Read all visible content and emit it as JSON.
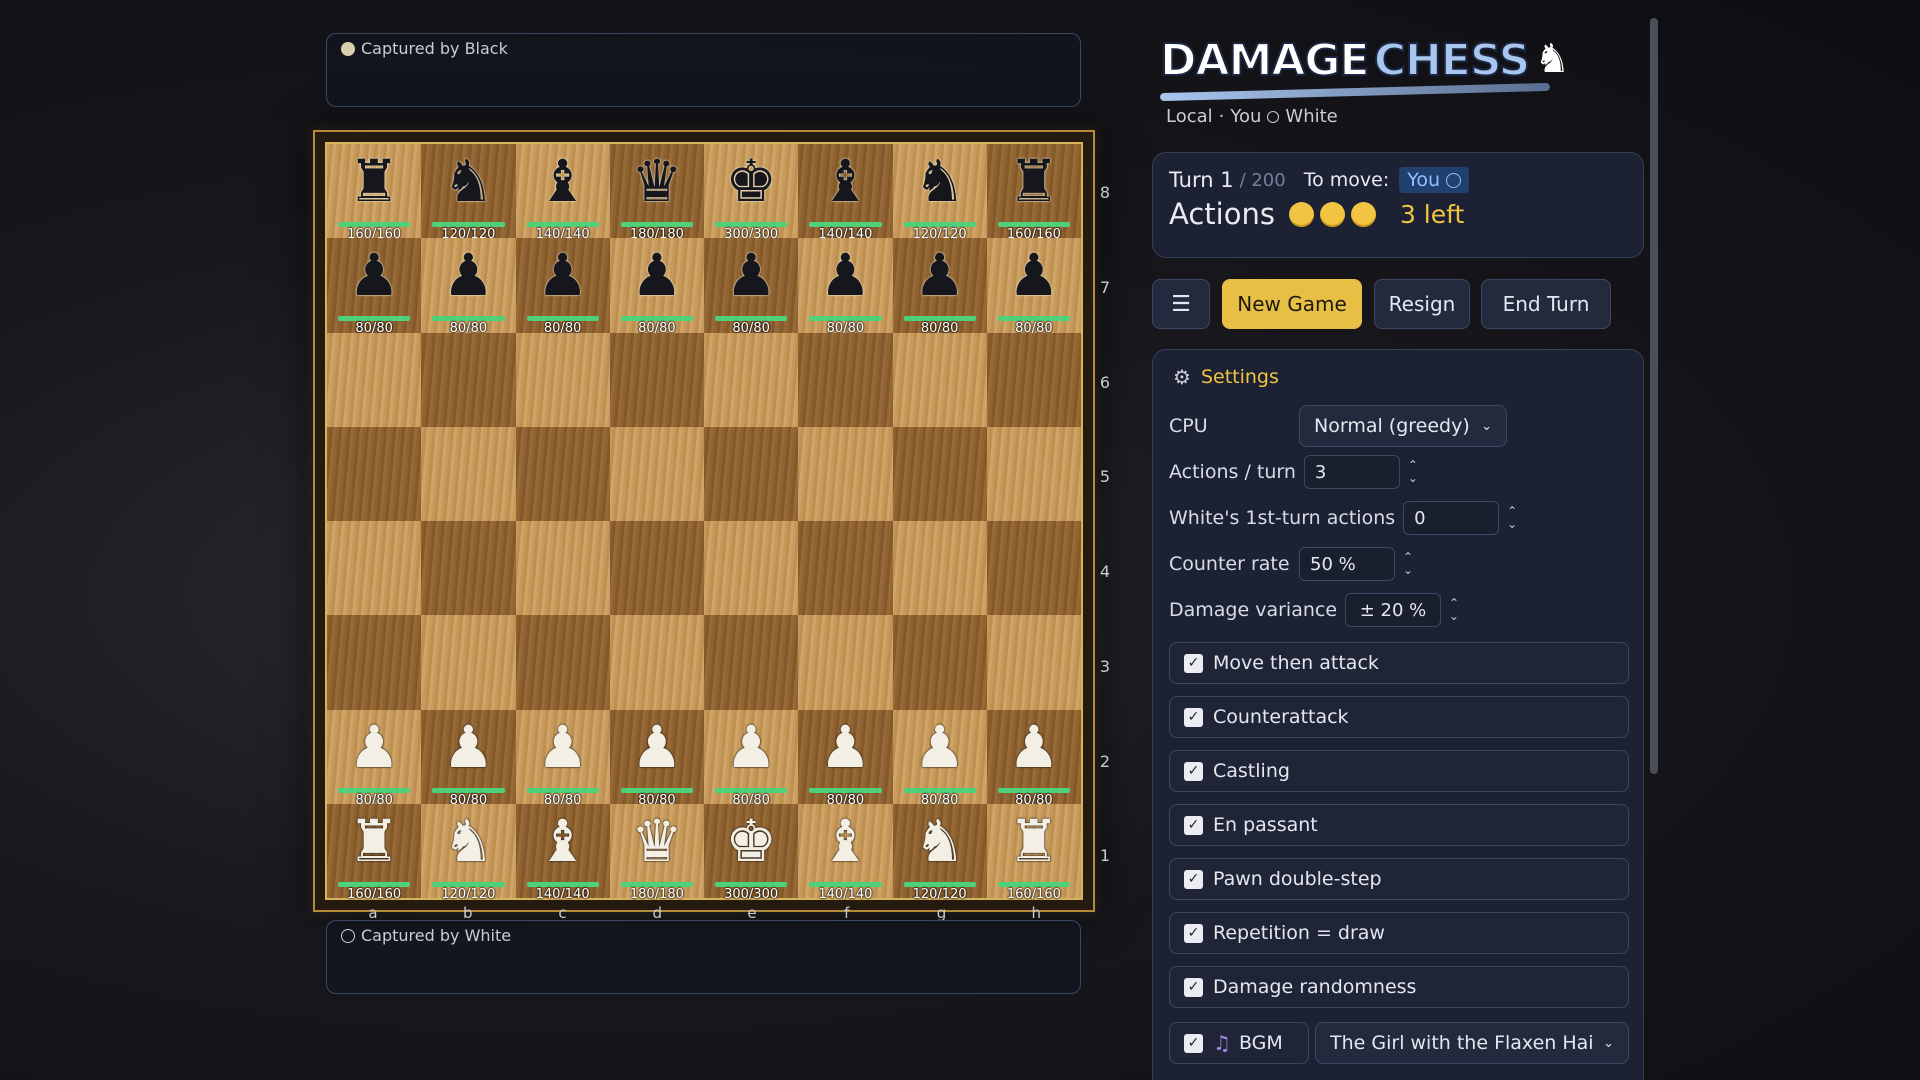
{
  "captured": {
    "top_label": "Captured by Black",
    "bottom_label": "Captured by White"
  },
  "board": {
    "files": [
      "a",
      "b",
      "c",
      "d",
      "e",
      "f",
      "g",
      "h"
    ],
    "ranks": [
      "8",
      "7",
      "6",
      "5",
      "4",
      "3",
      "2",
      "1"
    ],
    "pieces": [
      {
        "square": "a8",
        "color": "black",
        "type": "rook",
        "glyph": "♜",
        "hp": "160/160",
        "hp_fraction": 1.0
      },
      {
        "square": "b8",
        "color": "black",
        "type": "knight",
        "glyph": "♞",
        "hp": "120/120",
        "hp_fraction": 1.0
      },
      {
        "square": "c8",
        "color": "black",
        "type": "bishop",
        "glyph": "♝",
        "hp": "140/140",
        "hp_fraction": 1.0
      },
      {
        "square": "d8",
        "color": "black",
        "type": "queen",
        "glyph": "♛",
        "hp": "180/180",
        "hp_fraction": 1.0
      },
      {
        "square": "e8",
        "color": "black",
        "type": "king",
        "glyph": "♚",
        "hp": "300/300",
        "hp_fraction": 1.0
      },
      {
        "square": "f8",
        "color": "black",
        "type": "bishop",
        "glyph": "♝",
        "hp": "140/140",
        "hp_fraction": 1.0
      },
      {
        "square": "g8",
        "color": "black",
        "type": "knight",
        "glyph": "♞",
        "hp": "120/120",
        "hp_fraction": 1.0
      },
      {
        "square": "h8",
        "color": "black",
        "type": "rook",
        "glyph": "♜",
        "hp": "160/160",
        "hp_fraction": 1.0
      },
      {
        "square": "a7",
        "color": "black",
        "type": "pawn",
        "glyph": "♟",
        "hp": "80/80",
        "hp_fraction": 1.0
      },
      {
        "square": "b7",
        "color": "black",
        "type": "pawn",
        "glyph": "♟",
        "hp": "80/80",
        "hp_fraction": 1.0
      },
      {
        "square": "c7",
        "color": "black",
        "type": "pawn",
        "glyph": "♟",
        "hp": "80/80",
        "hp_fraction": 1.0
      },
      {
        "square": "d7",
        "color": "black",
        "type": "pawn",
        "glyph": "♟",
        "hp": "80/80",
        "hp_fraction": 1.0
      },
      {
        "square": "e7",
        "color": "black",
        "type": "pawn",
        "glyph": "♟",
        "hp": "80/80",
        "hp_fraction": 1.0
      },
      {
        "square": "f7",
        "color": "black",
        "type": "pawn",
        "glyph": "♟",
        "hp": "80/80",
        "hp_fraction": 1.0
      },
      {
        "square": "g7",
        "color": "black",
        "type": "pawn",
        "glyph": "♟",
        "hp": "80/80",
        "hp_fraction": 1.0
      },
      {
        "square": "h7",
        "color": "black",
        "type": "pawn",
        "glyph": "♟",
        "hp": "80/80",
        "hp_fraction": 1.0
      },
      {
        "square": "a2",
        "color": "white",
        "type": "pawn",
        "glyph": "♟",
        "hp": "80/80",
        "hp_fraction": 1.0
      },
      {
        "square": "b2",
        "color": "white",
        "type": "pawn",
        "glyph": "♟",
        "hp": "80/80",
        "hp_fraction": 1.0
      },
      {
        "square": "c2",
        "color": "white",
        "type": "pawn",
        "glyph": "♟",
        "hp": "80/80",
        "hp_fraction": 1.0
      },
      {
        "square": "d2",
        "color": "white",
        "type": "pawn",
        "glyph": "♟",
        "hp": "80/80",
        "hp_fraction": 1.0
      },
      {
        "square": "e2",
        "color": "white",
        "type": "pawn",
        "glyph": "♟",
        "hp": "80/80",
        "hp_fraction": 1.0
      },
      {
        "square": "f2",
        "color": "white",
        "type": "pawn",
        "glyph": "♟",
        "hp": "80/80",
        "hp_fraction": 1.0
      },
      {
        "square": "g2",
        "color": "white",
        "type": "pawn",
        "glyph": "♟",
        "hp": "80/80",
        "hp_fraction": 1.0
      },
      {
        "square": "h2",
        "color": "white",
        "type": "pawn",
        "glyph": "♟",
        "hp": "80/80",
        "hp_fraction": 1.0
      },
      {
        "square": "a1",
        "color": "white",
        "type": "rook",
        "glyph": "♜",
        "hp": "160/160",
        "hp_fraction": 1.0
      },
      {
        "square": "b1",
        "color": "white",
        "type": "knight",
        "glyph": "♞",
        "hp": "120/120",
        "hp_fraction": 1.0
      },
      {
        "square": "c1",
        "color": "white",
        "type": "bishop",
        "glyph": "♝",
        "hp": "140/140",
        "hp_fraction": 1.0
      },
      {
        "square": "d1",
        "color": "white",
        "type": "queen",
        "glyph": "♛",
        "hp": "180/180",
        "hp_fraction": 1.0
      },
      {
        "square": "e1",
        "color": "white",
        "type": "king",
        "glyph": "♚",
        "hp": "300/300",
        "hp_fraction": 1.0
      },
      {
        "square": "f1",
        "color": "white",
        "type": "bishop",
        "glyph": "♝",
        "hp": "140/140",
        "hp_fraction": 1.0
      },
      {
        "square": "g1",
        "color": "white",
        "type": "knight",
        "glyph": "♞",
        "hp": "120/120",
        "hp_fraction": 1.0
      },
      {
        "square": "h1",
        "color": "white",
        "type": "rook",
        "glyph": "♜",
        "hp": "160/160",
        "hp_fraction": 1.0
      }
    ]
  },
  "logo": {
    "word1": "DAMAGE",
    "word2": "CHESS",
    "icon": "knight-icon"
  },
  "mode": {
    "mode": "Local",
    "separator": "·",
    "player": "You",
    "side": "White"
  },
  "status": {
    "turn_label": "Turn 1",
    "turn_max": "/ 200",
    "to_move_label": "To move:",
    "to_move_value": "You",
    "actions_label": "Actions",
    "actions_total": 3,
    "actions_left": "3 left"
  },
  "buttons": {
    "menu_icon": "☰",
    "new_game": "New Game",
    "resign": "Resign",
    "end_turn": "End Turn"
  },
  "settings": {
    "title": "Settings",
    "cpu_label": "CPU",
    "cpu_value": "Normal (greedy)",
    "actions_per_turn_label": "Actions / turn",
    "actions_per_turn_value": "3",
    "white_first_label": "White's 1st-turn actions",
    "white_first_value": "0",
    "counter_rate_label": "Counter rate",
    "counter_rate_value": "50 %",
    "damage_variance_label": "Damage variance",
    "damage_variance_value": "± 20 %",
    "toggles": [
      {
        "label": "Move then attack",
        "checked": true
      },
      {
        "label": "Counterattack",
        "checked": true
      },
      {
        "label": "Castling",
        "checked": true
      },
      {
        "label": "En passant",
        "checked": true
      },
      {
        "label": "Pawn double-step",
        "checked": true
      },
      {
        "label": "Repetition = draw",
        "checked": true
      },
      {
        "label": "Damage randomness",
        "checked": true
      }
    ],
    "bgm_label": "BGM",
    "bgm_checked": true,
    "bgm_track": "The Girl with the Flaxen Hai"
  },
  "colors": {
    "accent_gold": "#f1c542",
    "hp_green": "#4ed17a",
    "you_blue": "#8fc0ff"
  }
}
